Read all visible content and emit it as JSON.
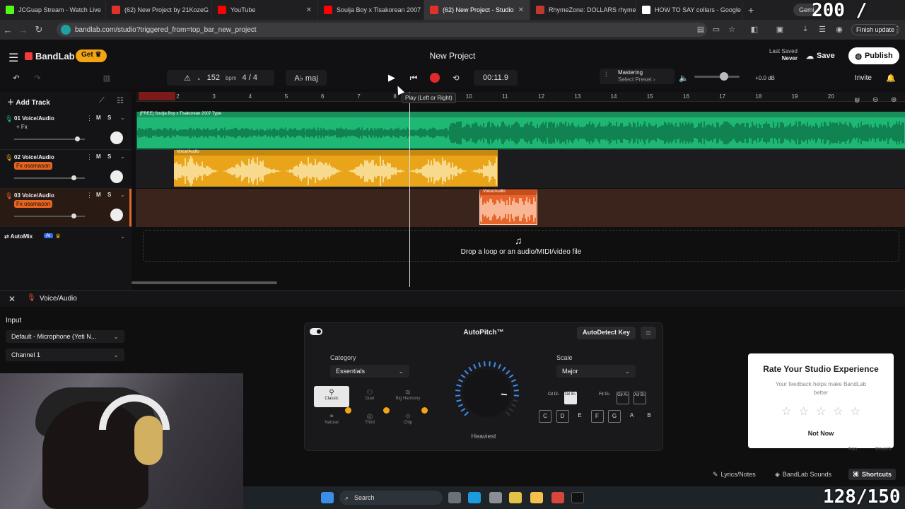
{
  "browser": {
    "tabs": [
      {
        "title": "JCGuap Stream - Watch Live",
        "color": "#53fc18",
        "active": false
      },
      {
        "title": "(62) New Project by 21KozeG",
        "color": "#e0322b",
        "active": false
      },
      {
        "title": "YouTube",
        "color": "#ff0000",
        "active": false
      },
      {
        "title": "Soulja Boy x Tisakorean 2007",
        "color": "#ff0000",
        "active": false
      },
      {
        "title": "(62) New Project - Studio",
        "color": "#e0322b",
        "active": true
      },
      {
        "title": "RhymeZone: DOLLARS rhyme",
        "color": "#c0392b",
        "active": false
      },
      {
        "title": "HOW TO SAY collars - Google",
        "color": "#ffffff",
        "active": false
      }
    ],
    "new_tab": "+",
    "gemini": "Gemi",
    "url": "bandlab.com/studio?triggered_from=top_bar_new_project",
    "finish_update": "Finish update"
  },
  "overlay": {
    "top": "200 / 260",
    "bottom": "128/150"
  },
  "header": {
    "brand": "BandLab",
    "get": "Get",
    "project_title": "New Project",
    "last_saved_label": "Last Saved",
    "last_saved_value": "Never",
    "save": "Save",
    "publish": "Publish"
  },
  "transport": {
    "tempo": "152",
    "tempo_unit": "bpm",
    "time_sig": "4 / 4",
    "key": "A♭ maj",
    "time": "00:11.9",
    "mastering": "Mastering",
    "mastering_preset": "Select Preset ›",
    "gain": "+0.0 dB",
    "invite": "Invite",
    "play_tooltip": "Play (Left or Right)"
  },
  "tracks_panel": {
    "add_track": "Add Track",
    "tracks": [
      {
        "name": "01  Voice/Audio",
        "fx": "+ Fx",
        "fx_color": "",
        "color": "#1fb774",
        "fader": 0.9
      },
      {
        "name": "02  Voice/Audio",
        "fx": "Fx  osamason",
        "fx_color": "#e8641f",
        "color": "#e9a419",
        "fader": 0.85
      },
      {
        "name": "03  Voice/Audio",
        "fx": "Fx  osamason",
        "fx_color": "#e8641f",
        "color": "#e8642d",
        "fader": 0.85
      }
    ],
    "mute": "M",
    "solo": "S",
    "automix": "AutoMix",
    "ai": "AI"
  },
  "ruler": [
    "1",
    "2",
    "3",
    "4",
    "5",
    "6",
    "7",
    "8",
    "9",
    "10",
    "11",
    "12",
    "13",
    "14",
    "15",
    "16",
    "17",
    "18",
    "19",
    "20"
  ],
  "clips": {
    "clip1": "[FREE] Soulja Boy x Tisakorean 2007 Type",
    "clip2": "Voice/Audio",
    "clip3": "Voice/Audio"
  },
  "drop_text": "Drop a loop or an audio/MIDI/video file",
  "bottom_panel": {
    "title": "Voice/Audio",
    "input_label": "Input",
    "input_device": "Default - Microphone (Yeti N...",
    "channel": "Channel 1"
  },
  "autopitch": {
    "title": "AutoPitch™",
    "autodetect": "AutoDetect Key",
    "category_label": "Category",
    "category": "Essentials",
    "presets": [
      "Classic",
      "Duet",
      "Big Harmony",
      "Natural",
      "Third",
      "Chip"
    ],
    "knob_label": "Heaviest",
    "knob_value": 0.85,
    "scale_label": "Scale",
    "scale": "Major",
    "sharps": [
      {
        "t": "C♯ D♭",
        "on": false,
        "out": false
      },
      {
        "t": "D♯ E♭",
        "on": true,
        "out": false
      },
      {
        "t": "F♯ G♭",
        "on": false,
        "out": false
      },
      {
        "t": "G♯ A♭",
        "on": false,
        "out": true
      },
      {
        "t": "A♯ B♭",
        "on": false,
        "out": true
      }
    ],
    "naturals": [
      {
        "t": "C",
        "out": true
      },
      {
        "t": "D",
        "out": true
      },
      {
        "t": "E",
        "out": false
      },
      {
        "t": "F",
        "out": true
      },
      {
        "t": "G",
        "out": true
      },
      {
        "t": "A",
        "out": false
      },
      {
        "t": "B",
        "out": false
      }
    ]
  },
  "rating": {
    "title": "Rate Your Studio Experience",
    "subtitle": "Your feedback helps make BandLab better",
    "stars": "☆☆☆☆☆",
    "not_now": "Not Now"
  },
  "faded": {
    "fan": "Fan",
    "reverb": "Reverb"
  },
  "footer_pills": [
    "Lyrics/Notes",
    "BandLab Sounds",
    "Shortcuts"
  ],
  "taskbar": {
    "search": "Search"
  }
}
